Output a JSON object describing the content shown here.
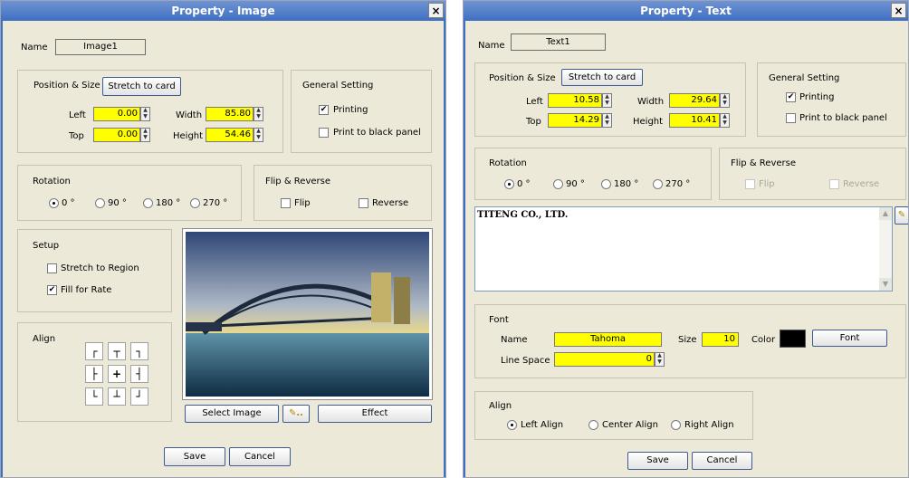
{
  "image_dialog": {
    "title": "Property - Image",
    "close": "×",
    "name_label": "Name",
    "name_value": "Image1",
    "position_size": {
      "label": "Position & Size",
      "stretch_btn": "Stretch to card",
      "left_label": "Left",
      "left": "0.00",
      "top_label": "Top",
      "top": "0.00",
      "width_label": "Width",
      "width": "85.80",
      "height_label": "Height",
      "height": "54.46"
    },
    "general": {
      "label": "General Setting",
      "printing": "Printing",
      "printing_checked": true,
      "black_panel": "Print to black panel",
      "black_panel_checked": false
    },
    "rotation": {
      "label": "Rotation",
      "options": [
        "0 °",
        "90 °",
        "180 °",
        "270 °"
      ],
      "selected": 0
    },
    "flip": {
      "label": "Flip & Reverse",
      "flip": "Flip",
      "reverse": "Reverse"
    },
    "setup": {
      "label": "Setup",
      "stretch_region": "Stretch to Region",
      "stretch_region_checked": false,
      "fill_rate": "Fill for Rate",
      "fill_rate_checked": true
    },
    "align": {
      "label": "Align",
      "glyphs": [
        "┌",
        "┬",
        "┐",
        "├",
        "+",
        "┤",
        "└",
        "┴",
        "┘"
      ]
    },
    "select_image": "Select Image",
    "effect": "Effect",
    "save": "Save",
    "cancel": "Cancel",
    "image_colors": {
      "sky_top": "#3a4f7a",
      "sky_mid": "#c3c9d1",
      "horizon": "#e8d07a",
      "water": "#2c6a86"
    }
  },
  "text_dialog": {
    "title": "Property - Text",
    "close": "×",
    "name_label": "Name",
    "name_value": "Text1",
    "position_size": {
      "label": "Position & Size",
      "stretch_btn": "Stretch to card",
      "left_label": "Left",
      "left": "10.58",
      "top_label": "Top",
      "top": "14.29",
      "width_label": "Width",
      "width": "29.64",
      "height_label": "Height",
      "height": "10.41"
    },
    "general": {
      "label": "General Setting",
      "printing": "Printing",
      "printing_checked": true,
      "black_panel": "Print to black panel",
      "black_panel_checked": false
    },
    "rotation": {
      "label": "Rotation",
      "options": [
        "0 °",
        "90 °",
        "180 °",
        "270 °"
      ],
      "selected": 0
    },
    "flip": {
      "label": "Flip & Reverse",
      "flip": "Flip",
      "reverse": "Reverse"
    },
    "text_value": "TITENG CO., LTD.",
    "font": {
      "label": "Font",
      "name_label": "Name",
      "name": "Tahoma",
      "size_label": "Size",
      "size": "10",
      "color_label": "Color",
      "color": "#000000",
      "font_btn": "Font",
      "line_space_label": "Line Space",
      "line_space": "0"
    },
    "align": {
      "label": "Align",
      "options": [
        "Left Align",
        "Center Align",
        "Right Align"
      ],
      "selected": 0
    },
    "save": "Save",
    "cancel": "Cancel"
  },
  "colors": {
    "title_bar": "#3f6fc2",
    "dialog_bg": "#ece9d8",
    "highlight": "#ffff00"
  }
}
